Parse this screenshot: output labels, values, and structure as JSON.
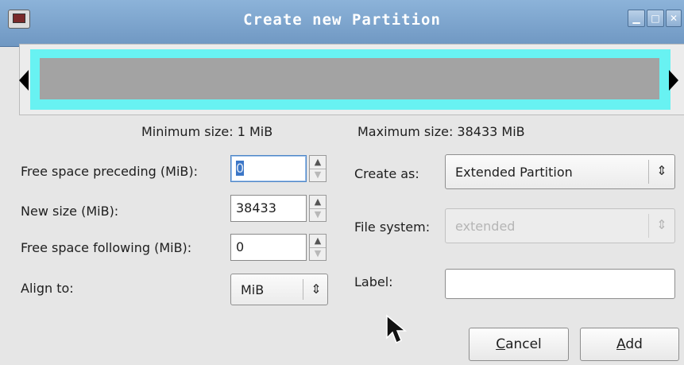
{
  "window": {
    "title": "Create new Partition",
    "buttons": [
      "minimize",
      "maximize",
      "close"
    ]
  },
  "sizes": {
    "minimum": "Minimum size: 1 MiB",
    "maximum": "Maximum size: 38433 MiB"
  },
  "fields": {
    "free_preceding": {
      "label": "Free space preceding (MiB):",
      "value": "0"
    },
    "new_size": {
      "label": "New size (MiB):",
      "value": "38433"
    },
    "free_following": {
      "label": "Free space following (MiB):",
      "value": "0"
    },
    "align_to": {
      "label": "Align to:",
      "value": "MiB"
    }
  },
  "right": {
    "create_as": {
      "label": "Create as:",
      "value": "Extended Partition"
    },
    "file_system": {
      "label": "File system:",
      "value": "extended"
    },
    "label": {
      "label": "Label:",
      "value": ""
    }
  },
  "actions": {
    "cancel_prefix": "C",
    "cancel_rest": "ancel",
    "add_prefix": "A",
    "add_rest": "dd"
  },
  "colors": {
    "partition_border": "#68f2f2",
    "partition_fill": "#a3a3a3"
  }
}
